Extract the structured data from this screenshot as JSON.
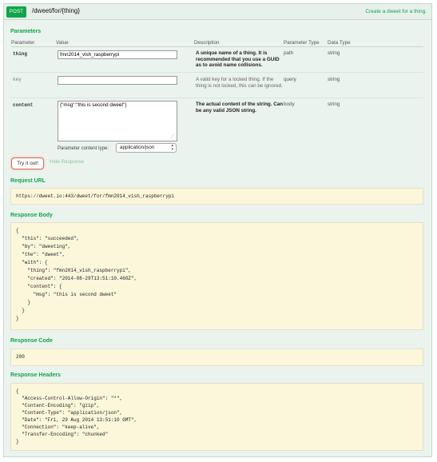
{
  "endpoint": {
    "method": "POST",
    "path": "/dweet/for/{thing}",
    "summary": "Create a dweet for a thing."
  },
  "parameters": {
    "title": "Parameters",
    "columns": [
      "Parameter",
      "Value",
      "Description",
      "Parameter Type",
      "Data Type"
    ],
    "rows": [
      {
        "name": "thing",
        "value": "fmn2014_vish_raspberrypi",
        "description": "A unique name of a thing.  It is recommended that you use a GUID as to  avoid name collisions.",
        "param_type": "path",
        "data_type": "string"
      },
      {
        "name": "key",
        "value": "",
        "description": "A valid key for a locked thing. If the thing is not locked, this can be ignored.",
        "param_type": "query",
        "data_type": "string"
      },
      {
        "name": "content",
        "value": "{\"msg\":\"this is second dweet\"}",
        "description": "The actual  content of the string. Can be any valid JSON string.",
        "param_type": "body",
        "data_type": "string"
      }
    ],
    "content_type_label": "Parameter content type:",
    "content_type_value": "application/json"
  },
  "actions": {
    "try_label": "Try it out!",
    "hide_label": "Hide Response"
  },
  "request_url": {
    "title": "Request URL",
    "value": "https://dweet.io:443/dweet/for/fmn2014_vish_raspberrypi"
  },
  "response_body": {
    "title": "Response Body",
    "value": "{\n  \"this\": \"succeeded\",\n  \"by\": \"dweeting\",\n  \"the\": \"dweet\",\n  \"with\": {\n    \"thing\": \"fmn2014_vish_raspberrypi\",\n    \"created\": \"2014-08-29T13:51:10.460Z\",\n    \"content\": {\n      \"msg\": \"this is second dweet\"\n    }\n  }\n}"
  },
  "response_code": {
    "title": "Response Code",
    "value": "200"
  },
  "response_headers": {
    "title": "Response Headers",
    "value": "{\n  \"Access-Control-Allow-Origin\": \"*\",\n  \"Content-Encoding\": \"gzip\",\n  \"Content-Type\": \"application/json\",\n  \"Date\": \"Fri, 29 Aug 2014 13:51:10 GMT\",\n  \"Connection\": \"keep-alive\",\n  \"Transfer-Encoding\": \"chunked\"\n}"
  },
  "colors": {
    "accent": "#10a54a",
    "panel_bg": "#ebf3ee",
    "code_bg": "#fcf6db",
    "button_border": "#e06a4b"
  }
}
